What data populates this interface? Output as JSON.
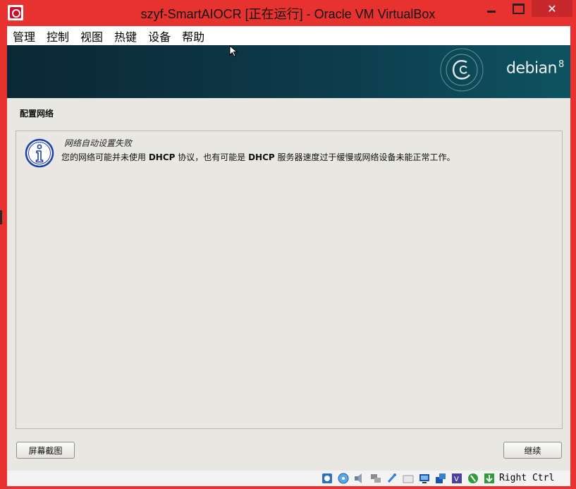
{
  "window": {
    "title": "szyf-SmartAIOCR [正在运行] - Oracle VM VirtualBox",
    "close_glyph": "✕"
  },
  "menubar": {
    "items": [
      {
        "label": "管理"
      },
      {
        "label": "控制"
      },
      {
        "label": "视图"
      },
      {
        "label": "热键"
      },
      {
        "label": "设备"
      },
      {
        "label": "帮助"
      }
    ]
  },
  "installer": {
    "brand": "debian",
    "brand_version": "8",
    "section_title": "配置网络",
    "message_title": "网络自动设置失败",
    "message_body_1": "您的网络可能并未使用 ",
    "message_body_2": "DHCP",
    "message_body_3": " 协议，也有可能是 ",
    "message_body_4": "DHCP",
    "message_body_5": " 服务器速度过于缓慢或网络设备未能正常工作。",
    "screenshot_button": "屏幕截图",
    "continue_button": "继续"
  },
  "statusbar": {
    "host_key": "Right Ctrl",
    "icons": [
      "hard-disk-icon",
      "optical-drive-icon",
      "audio-icon",
      "network-icon",
      "usb-icon",
      "shared-folder-icon",
      "display-icon",
      "video-capture-icon",
      "virtualization-icon",
      "mouse-integration-icon",
      "keyboard-capture-icon"
    ]
  },
  "colors": {
    "titlebar": "#e8322f",
    "banner": "#0c2735",
    "vm_background": "#e8e7e1"
  }
}
